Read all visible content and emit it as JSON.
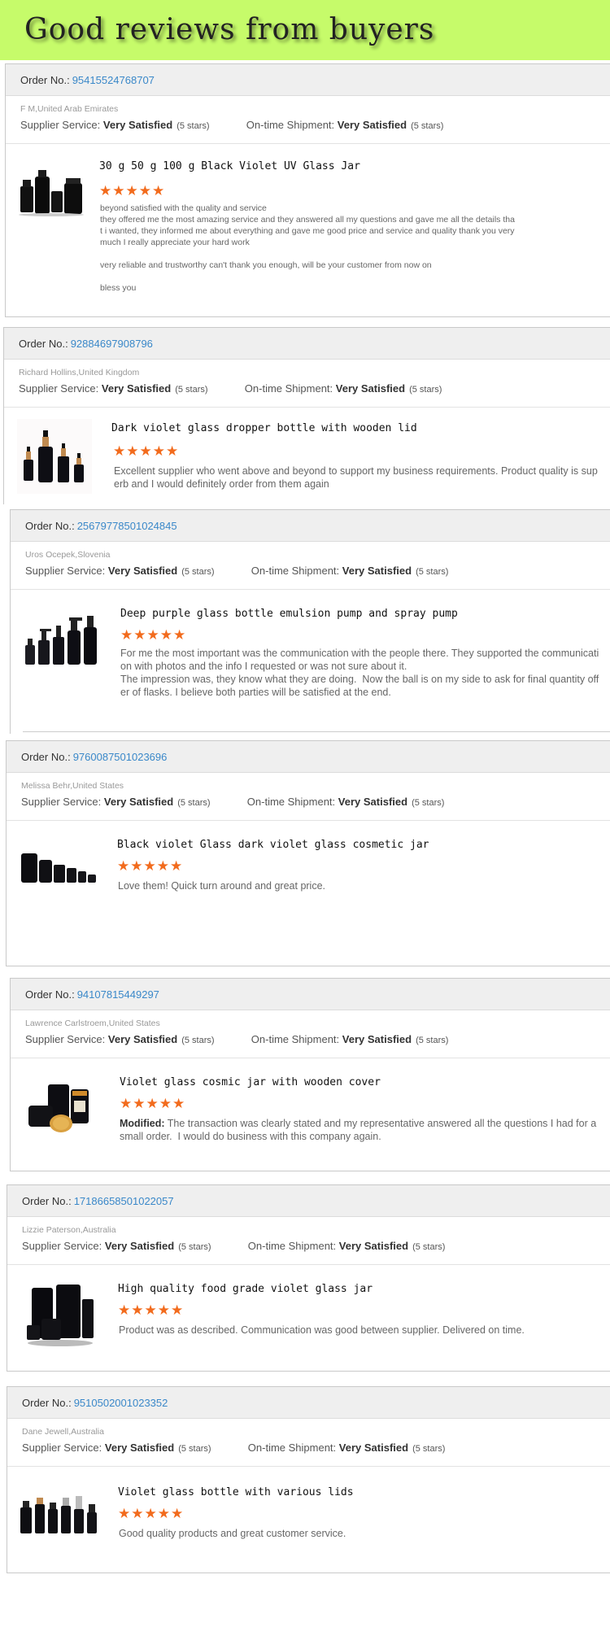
{
  "banner": {
    "title": "Good reviews from buyers"
  },
  "labels": {
    "order_no": "Order No.:",
    "supplier_service": "Supplier Service:",
    "ontime_shipment": "On-time Shipment:",
    "stars_text": "★★★★★",
    "modified": "Modified:"
  },
  "colors": {
    "banner_bg": "#c6fb6a",
    "order_link": "#3a88c9",
    "star": "#f26b1d"
  },
  "reviews": [
    {
      "order_number": "95415524768707",
      "buyer": "F M,United Arab Emirates",
      "supplier_rating": "Very Satisfied",
      "supplier_stars": "(5 stars)",
      "shipment_rating": "Very Satisfied",
      "shipment_stars": "(5 stars)",
      "product": "30 g 50 g 100 g Black Violet UV Glass Jar",
      "stars": 5,
      "comment": "beyond satisfied with the quality and service\nthey offered me the most amazing service and they answered all my questions and gave me all the details that i wanted, they informed me about everything and gave me good price and service and quality thank you very much I really appreciate your hard work\n\nvery reliable and trustworthy can't thank you enough, will be your customer from now on\n\nbless you",
      "image_icon": "black-jars-set-icon"
    },
    {
      "order_number": "92884697908796",
      "buyer": "Richard Hollins,United Kingdom",
      "supplier_rating": "Very Satisfied",
      "supplier_stars": "(5 stars)",
      "shipment_rating": "Very Satisfied",
      "shipment_stars": "(5 stars)",
      "product": "Dark violet glass dropper bottle with wooden lid",
      "stars": 5,
      "comment": "Excellent supplier who went above and beyond to support my business requirements. Product quality is superb and I would definitely order from them again",
      "image_icon": "dropper-bottles-icon"
    },
    {
      "order_number": "25679778501024845",
      "buyer": "Uros Ocepek,Slovenia",
      "supplier_rating": "Very Satisfied",
      "supplier_stars": "(5 stars)",
      "shipment_rating": "Very Satisfied",
      "shipment_stars": "(5 stars)",
      "product": "Deep purple glass bottle emulsion pump and spray pump",
      "stars": 5,
      "comment": "For me the most important was the communication with the people there. They supported the communication with photos and the info I requested or was not sure about it.\nThe impression was, they know what they are doing.  Now the ball is on my side to ask for final quantity offer of flasks. I believe both parties will be satisfied at the end.",
      "image_icon": "pump-bottles-icon"
    },
    {
      "order_number": "9760087501023696",
      "buyer": "Melissa Behr,United States",
      "supplier_rating": "Very Satisfied",
      "supplier_stars": "(5 stars)",
      "shipment_rating": "Very Satisfied",
      "shipment_stars": "(5 stars)",
      "product": "Black violet Glass  dark violet glass cosmetic jar",
      "stars": 5,
      "comment": "Love them! Quick turn around and great price.",
      "image_icon": "cosmetic-jars-icon"
    },
    {
      "order_number": "94107815449297",
      "buyer": "Lawrence Carlstroem,United States",
      "supplier_rating": "Very Satisfied",
      "supplier_stars": "(5 stars)",
      "shipment_rating": "Very Satisfied",
      "shipment_stars": "(5 stars)",
      "product": "Violet glass cosmic jar with wooden cover",
      "stars": 5,
      "comment": "The transaction was clearly stated and my representative answered all the questions I had for a small order.  I would do business with this company again.",
      "image_icon": "wooden-lid-jars-icon"
    },
    {
      "order_number": "17186658501022057",
      "buyer": "Lizzie Paterson,Australia",
      "supplier_rating": "Very Satisfied",
      "supplier_stars": "(5 stars)",
      "shipment_rating": "Very Satisfied",
      "shipment_stars": "(5 stars)",
      "product": "High quality food grade violet glass jar",
      "stars": 5,
      "comment": "Product was as described. Communication was good between supplier. Delivered on time.",
      "image_icon": "food-jars-icon"
    },
    {
      "order_number": "9510502001023352",
      "buyer": "Dane Jewell,Australia",
      "supplier_rating": "Very Satisfied",
      "supplier_stars": "(5 stars)",
      "shipment_rating": "Very Satisfied",
      "shipment_stars": "(5 stars)",
      "product": "Violet glass bottle with various lids",
      "stars": 5,
      "comment": "Good quality products and great customer service.",
      "image_icon": "assorted-bottles-icon"
    }
  ]
}
